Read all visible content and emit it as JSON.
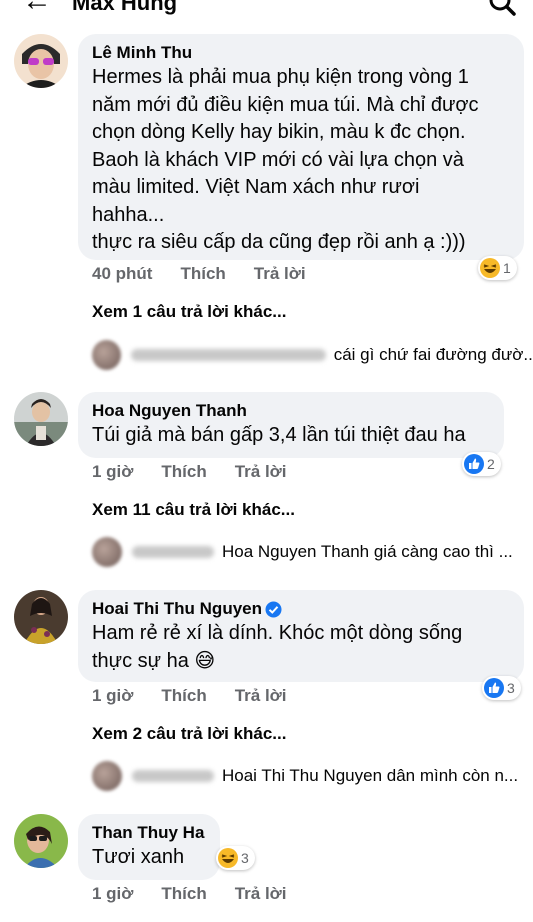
{
  "header": {
    "title": "Max Hùng",
    "back_icon": "arrow-left-icon",
    "search_icon": "search-icon"
  },
  "comments": [
    {
      "author": "Lê Minh Thu",
      "lines": [
        "Hermes là phải mua phụ kiện trong vòng 1",
        "năm mới đủ điều kiện mua túi. Mà chỉ được",
        "chọn dòng Kelly hay bikin, màu k đc chọn.",
        "Baoh là khách VIP mới có vài lựa chọn và",
        "màu limited. Việt Nam xách như rươi",
        "hahha...",
        "thực ra siêu cấp da cũng đẹp rồi anh ạ :)))"
      ],
      "time": "40 phút",
      "like": "Thích",
      "reply": "Trả lời",
      "reaction": {
        "type": "haha",
        "count": "1"
      },
      "more_replies": "Xem 1 câu trả lời khác...",
      "reply_preview": "cái gì chứ fai đường đườ..."
    },
    {
      "author": "Hoa Nguyen Thanh",
      "lines": [
        "Túi giả mà bán gấp 3,4 lần túi thiệt đau ha"
      ],
      "time": "1 giờ",
      "like": "Thích",
      "reply": "Trả lời",
      "reaction": {
        "type": "like",
        "count": "2"
      },
      "more_replies": "Xem 11 câu trả lời khác...",
      "reply_preview": "Hoa Nguyen Thanh giá càng cao thì ..."
    },
    {
      "author": "Hoai Thi Thu Nguyen",
      "verified": true,
      "lines": [
        "Ham rẻ rẻ xí là dính. Khóc một dòng sống",
        "thực sự ha 😅"
      ],
      "time": "1 giờ",
      "like": "Thích",
      "reply": "Trả lời",
      "reaction": {
        "type": "like",
        "count": "3"
      },
      "more_replies": "Xem 2 câu trả lời khác...",
      "reply_preview": "Hoai Thi Thu Nguyen dân mình còn n..."
    },
    {
      "author": "Than Thuy Ha",
      "lines": [
        "Tươi xanh"
      ],
      "time": "1 giờ",
      "like": "Thích",
      "reply": "Trả lời",
      "reaction": {
        "type": "haha",
        "count": "3"
      }
    }
  ],
  "colors": {
    "bubble": "#f0f2f5",
    "meta": "#65676b",
    "like_blue": "#1877f2",
    "haha_yellow": "#f7b928"
  }
}
